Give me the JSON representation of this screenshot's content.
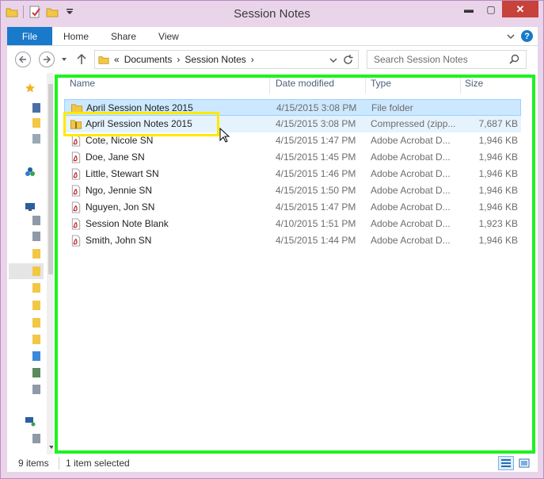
{
  "window": {
    "title": "Session Notes",
    "controls": {
      "minimize": "▬",
      "maximize": "▢",
      "close": "✕"
    }
  },
  "ribbon": {
    "file": "File",
    "tabs": [
      "Home",
      "Share",
      "View"
    ]
  },
  "address": {
    "back_icon": "back-arrow-icon",
    "forward_icon": "forward-arrow-icon",
    "up_icon": "up-arrow-icon",
    "overflow": "«",
    "path": [
      "Documents",
      "Session Notes"
    ],
    "search_placeholder": "Search Session Notes"
  },
  "columns": {
    "name": "Name",
    "date": "Date modified",
    "type": "Type",
    "size": "Size"
  },
  "files": [
    {
      "name": "April Session Notes 2015",
      "date": "4/15/2015 3:08 PM",
      "type": "File folder",
      "size": "",
      "icon": "folder-icon",
      "state": "selected"
    },
    {
      "name": "April Session Notes 2015",
      "date": "4/15/2015 3:08 PM",
      "type": "Compressed (zipp...",
      "size": "7,687 KB",
      "icon": "zip-folder-icon",
      "state": "hover"
    },
    {
      "name": "Cote, Nicole SN",
      "date": "4/15/2015 1:47 PM",
      "type": "Adobe Acrobat D...",
      "size": "1,946 KB",
      "icon": "pdf-icon",
      "state": ""
    },
    {
      "name": "Doe, Jane SN",
      "date": "4/15/2015 1:45 PM",
      "type": "Adobe Acrobat D...",
      "size": "1,946 KB",
      "icon": "pdf-icon",
      "state": ""
    },
    {
      "name": "Little, Stewart SN",
      "date": "4/15/2015 1:46 PM",
      "type": "Adobe Acrobat D...",
      "size": "1,946 KB",
      "icon": "pdf-icon",
      "state": ""
    },
    {
      "name": "Ngo, Jennie SN",
      "date": "4/15/2015 1:50 PM",
      "type": "Adobe Acrobat D...",
      "size": "1,946 KB",
      "icon": "pdf-icon",
      "state": ""
    },
    {
      "name": "Nguyen, Jon SN",
      "date": "4/15/2015 1:47 PM",
      "type": "Adobe Acrobat D...",
      "size": "1,946 KB",
      "icon": "pdf-icon",
      "state": ""
    },
    {
      "name": "Session Note Blank",
      "date": "4/10/2015 1:51 PM",
      "type": "Adobe Acrobat D...",
      "size": "1,923 KB",
      "icon": "pdf-icon",
      "state": ""
    },
    {
      "name": "Smith, John SN",
      "date": "4/15/2015 1:44 PM",
      "type": "Adobe Acrobat D...",
      "size": "1,946 KB",
      "icon": "pdf-icon",
      "state": ""
    }
  ],
  "status": {
    "count": "9 items",
    "selected": "1 item selected"
  },
  "colors": {
    "accent": "#1979ca",
    "selection": "#cce8ff",
    "highlight_green": "#1ef31e",
    "highlight_yellow": "#ffe900"
  }
}
